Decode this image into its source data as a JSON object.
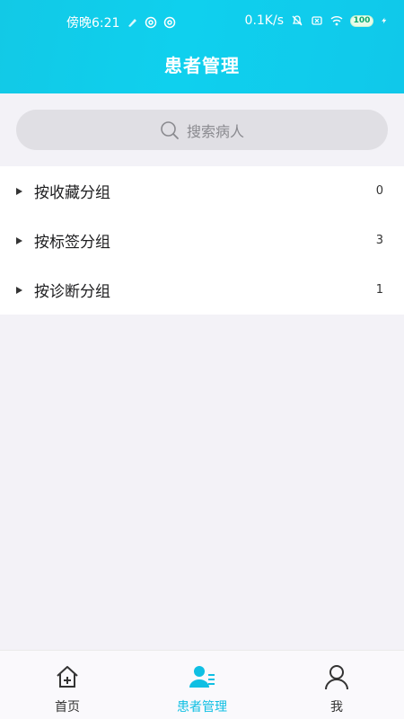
{
  "status_bar": {
    "time": "傍晚6:21",
    "network_speed": "0.1K/s",
    "battery": "100"
  },
  "header": {
    "title": "患者管理",
    "accent_color": "#12c9e6"
  },
  "search": {
    "placeholder": "搜索病人"
  },
  "groups": [
    {
      "label": "按收藏分组",
      "count": "0"
    },
    {
      "label": "按标签分组",
      "count": "3"
    },
    {
      "label": "按诊断分组",
      "count": "1"
    }
  ],
  "bottom_nav": {
    "tabs": [
      {
        "label": "首页",
        "icon": "home-icon",
        "active": false
      },
      {
        "label": "患者管理",
        "icon": "patients-icon",
        "active": true
      },
      {
        "label": "我",
        "icon": "person-icon",
        "active": false
      }
    ]
  }
}
